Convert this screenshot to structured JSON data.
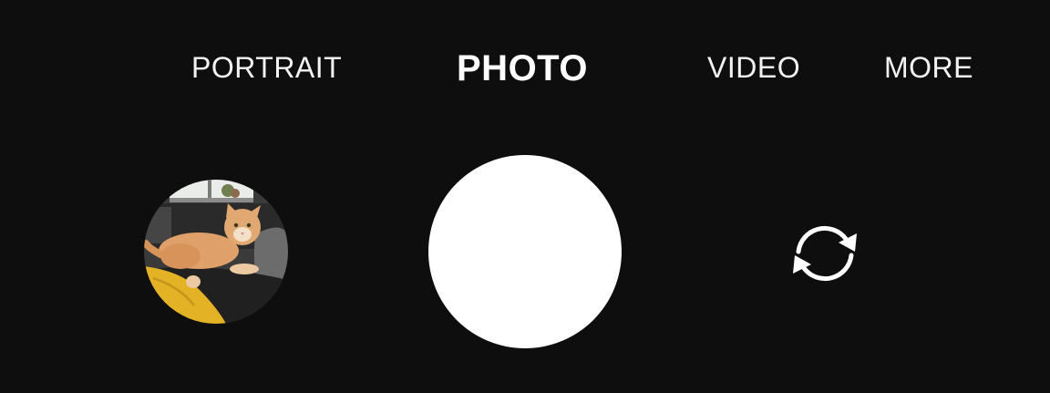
{
  "modes": {
    "portrait": "PORTRAIT",
    "photo": "PHOTO",
    "video": "VIDEO",
    "more": "MORE",
    "active": "photo"
  },
  "controls": {
    "gallery_icon": "gallery-thumbnail",
    "shutter_icon": "shutter",
    "switch_icon": "switch-camera-icon"
  },
  "colors": {
    "background": "#0e0e0e",
    "foreground": "#ffffff"
  }
}
